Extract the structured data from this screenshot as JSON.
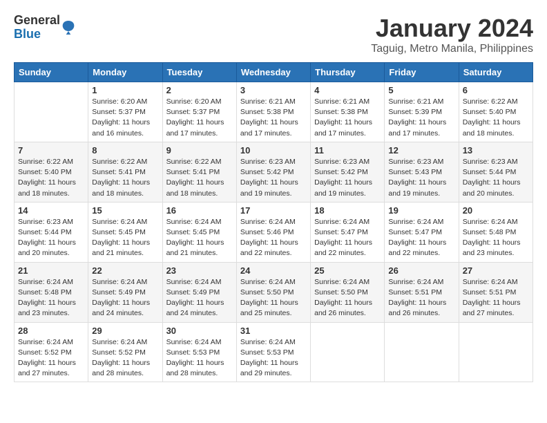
{
  "header": {
    "logo_general": "General",
    "logo_blue": "Blue",
    "month_title": "January 2024",
    "location": "Taguig, Metro Manila, Philippines"
  },
  "calendar": {
    "days_of_week": [
      "Sunday",
      "Monday",
      "Tuesday",
      "Wednesday",
      "Thursday",
      "Friday",
      "Saturday"
    ],
    "weeks": [
      [
        {
          "day": "",
          "sunrise": "",
          "sunset": "",
          "daylight": ""
        },
        {
          "day": "1",
          "sunrise": "Sunrise: 6:20 AM",
          "sunset": "Sunset: 5:37 PM",
          "daylight": "Daylight: 11 hours and 16 minutes."
        },
        {
          "day": "2",
          "sunrise": "Sunrise: 6:20 AM",
          "sunset": "Sunset: 5:37 PM",
          "daylight": "Daylight: 11 hours and 17 minutes."
        },
        {
          "day": "3",
          "sunrise": "Sunrise: 6:21 AM",
          "sunset": "Sunset: 5:38 PM",
          "daylight": "Daylight: 11 hours and 17 minutes."
        },
        {
          "day": "4",
          "sunrise": "Sunrise: 6:21 AM",
          "sunset": "Sunset: 5:38 PM",
          "daylight": "Daylight: 11 hours and 17 minutes."
        },
        {
          "day": "5",
          "sunrise": "Sunrise: 6:21 AM",
          "sunset": "Sunset: 5:39 PM",
          "daylight": "Daylight: 11 hours and 17 minutes."
        },
        {
          "day": "6",
          "sunrise": "Sunrise: 6:22 AM",
          "sunset": "Sunset: 5:40 PM",
          "daylight": "Daylight: 11 hours and 18 minutes."
        }
      ],
      [
        {
          "day": "7",
          "sunrise": "Sunrise: 6:22 AM",
          "sunset": "Sunset: 5:40 PM",
          "daylight": "Daylight: 11 hours and 18 minutes."
        },
        {
          "day": "8",
          "sunrise": "Sunrise: 6:22 AM",
          "sunset": "Sunset: 5:41 PM",
          "daylight": "Daylight: 11 hours and 18 minutes."
        },
        {
          "day": "9",
          "sunrise": "Sunrise: 6:22 AM",
          "sunset": "Sunset: 5:41 PM",
          "daylight": "Daylight: 11 hours and 18 minutes."
        },
        {
          "day": "10",
          "sunrise": "Sunrise: 6:23 AM",
          "sunset": "Sunset: 5:42 PM",
          "daylight": "Daylight: 11 hours and 19 minutes."
        },
        {
          "day": "11",
          "sunrise": "Sunrise: 6:23 AM",
          "sunset": "Sunset: 5:42 PM",
          "daylight": "Daylight: 11 hours and 19 minutes."
        },
        {
          "day": "12",
          "sunrise": "Sunrise: 6:23 AM",
          "sunset": "Sunset: 5:43 PM",
          "daylight": "Daylight: 11 hours and 19 minutes."
        },
        {
          "day": "13",
          "sunrise": "Sunrise: 6:23 AM",
          "sunset": "Sunset: 5:44 PM",
          "daylight": "Daylight: 11 hours and 20 minutes."
        }
      ],
      [
        {
          "day": "14",
          "sunrise": "Sunrise: 6:23 AM",
          "sunset": "Sunset: 5:44 PM",
          "daylight": "Daylight: 11 hours and 20 minutes."
        },
        {
          "day": "15",
          "sunrise": "Sunrise: 6:24 AM",
          "sunset": "Sunset: 5:45 PM",
          "daylight": "Daylight: 11 hours and 21 minutes."
        },
        {
          "day": "16",
          "sunrise": "Sunrise: 6:24 AM",
          "sunset": "Sunset: 5:45 PM",
          "daylight": "Daylight: 11 hours and 21 minutes."
        },
        {
          "day": "17",
          "sunrise": "Sunrise: 6:24 AM",
          "sunset": "Sunset: 5:46 PM",
          "daylight": "Daylight: 11 hours and 22 minutes."
        },
        {
          "day": "18",
          "sunrise": "Sunrise: 6:24 AM",
          "sunset": "Sunset: 5:47 PM",
          "daylight": "Daylight: 11 hours and 22 minutes."
        },
        {
          "day": "19",
          "sunrise": "Sunrise: 6:24 AM",
          "sunset": "Sunset: 5:47 PM",
          "daylight": "Daylight: 11 hours and 22 minutes."
        },
        {
          "day": "20",
          "sunrise": "Sunrise: 6:24 AM",
          "sunset": "Sunset: 5:48 PM",
          "daylight": "Daylight: 11 hours and 23 minutes."
        }
      ],
      [
        {
          "day": "21",
          "sunrise": "Sunrise: 6:24 AM",
          "sunset": "Sunset: 5:48 PM",
          "daylight": "Daylight: 11 hours and 23 minutes."
        },
        {
          "day": "22",
          "sunrise": "Sunrise: 6:24 AM",
          "sunset": "Sunset: 5:49 PM",
          "daylight": "Daylight: 11 hours and 24 minutes."
        },
        {
          "day": "23",
          "sunrise": "Sunrise: 6:24 AM",
          "sunset": "Sunset: 5:49 PM",
          "daylight": "Daylight: 11 hours and 24 minutes."
        },
        {
          "day": "24",
          "sunrise": "Sunrise: 6:24 AM",
          "sunset": "Sunset: 5:50 PM",
          "daylight": "Daylight: 11 hours and 25 minutes."
        },
        {
          "day": "25",
          "sunrise": "Sunrise: 6:24 AM",
          "sunset": "Sunset: 5:50 PM",
          "daylight": "Daylight: 11 hours and 26 minutes."
        },
        {
          "day": "26",
          "sunrise": "Sunrise: 6:24 AM",
          "sunset": "Sunset: 5:51 PM",
          "daylight": "Daylight: 11 hours and 26 minutes."
        },
        {
          "day": "27",
          "sunrise": "Sunrise: 6:24 AM",
          "sunset": "Sunset: 5:51 PM",
          "daylight": "Daylight: 11 hours and 27 minutes."
        }
      ],
      [
        {
          "day": "28",
          "sunrise": "Sunrise: 6:24 AM",
          "sunset": "Sunset: 5:52 PM",
          "daylight": "Daylight: 11 hours and 27 minutes."
        },
        {
          "day": "29",
          "sunrise": "Sunrise: 6:24 AM",
          "sunset": "Sunset: 5:52 PM",
          "daylight": "Daylight: 11 hours and 28 minutes."
        },
        {
          "day": "30",
          "sunrise": "Sunrise: 6:24 AM",
          "sunset": "Sunset: 5:53 PM",
          "daylight": "Daylight: 11 hours and 28 minutes."
        },
        {
          "day": "31",
          "sunrise": "Sunrise: 6:24 AM",
          "sunset": "Sunset: 5:53 PM",
          "daylight": "Daylight: 11 hours and 29 minutes."
        },
        {
          "day": "",
          "sunrise": "",
          "sunset": "",
          "daylight": ""
        },
        {
          "day": "",
          "sunrise": "",
          "sunset": "",
          "daylight": ""
        },
        {
          "day": "",
          "sunrise": "",
          "sunset": "",
          "daylight": ""
        }
      ]
    ]
  }
}
